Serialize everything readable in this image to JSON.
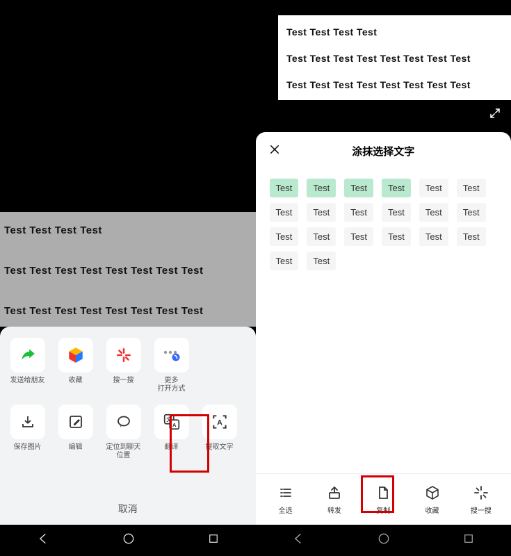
{
  "left": {
    "preview_lines": [
      "Test Test Test Test",
      "Test Test Test Test Test Test Test Test",
      "Test Test Test Test Test Test Test Test"
    ],
    "row1": [
      {
        "label": "发送给朋友",
        "icon": "share-arrow"
      },
      {
        "label": "收藏",
        "icon": "cube"
      },
      {
        "label": "搜一搜",
        "icon": "spark"
      },
      {
        "label": "更多\n打开方式",
        "icon": "more"
      }
    ],
    "row2": [
      {
        "label": "保存图片",
        "icon": "download"
      },
      {
        "label": "编辑",
        "icon": "edit"
      },
      {
        "label": "定位到聊天\n位置",
        "icon": "chat"
      },
      {
        "label": "翻译",
        "icon": "translate"
      },
      {
        "label": "提取文字",
        "icon": "extract-text"
      }
    ],
    "cancel_label": "取消"
  },
  "right": {
    "card_lines": [
      "Test Test Test Test",
      "Test Test Test Test Test Test Test Test",
      "Test Test Test Test Test Test Test Test"
    ],
    "panel_title": "涂抹选择文字",
    "tokens": [
      {
        "t": "Test",
        "s": true
      },
      {
        "t": "Test",
        "s": true
      },
      {
        "t": "Test",
        "s": true
      },
      {
        "t": "Test",
        "s": true
      },
      {
        "t": "Test"
      },
      {
        "t": "Test"
      },
      {
        "t": "Test"
      },
      {
        "t": "Test"
      },
      {
        "t": "Test"
      },
      {
        "t": "Test"
      },
      {
        "t": "Test"
      },
      {
        "t": "Test"
      },
      {
        "t": "Test"
      },
      {
        "t": "Test"
      },
      {
        "t": "Test"
      },
      {
        "t": "Test"
      },
      {
        "t": "Test"
      },
      {
        "t": "Test"
      },
      {
        "t": "Test"
      },
      {
        "t": "Test"
      }
    ],
    "bottom_bar": [
      {
        "label": "全选",
        "icon": "select-all"
      },
      {
        "label": "转发",
        "icon": "forward"
      },
      {
        "label": "复制",
        "icon": "copy"
      },
      {
        "label": "收藏",
        "icon": "fav-cube"
      },
      {
        "label": "搜一搜",
        "icon": "spark-outline"
      }
    ]
  }
}
